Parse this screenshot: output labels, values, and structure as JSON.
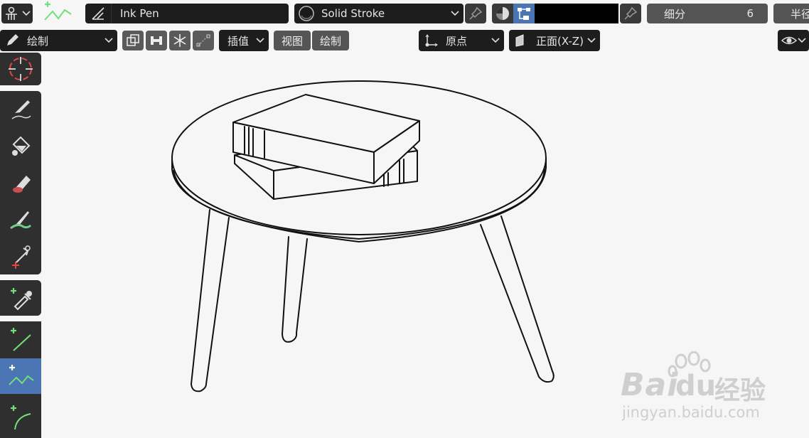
{
  "header": {
    "brush_name": "Ink Pen",
    "material_name": "Solid Stroke",
    "subdivision_label": "细分",
    "subdivision_value": "6",
    "radius_label": "半径"
  },
  "toolbar2": {
    "mode_label": "绘制",
    "interpolate_label": "插值",
    "view_label": "视图",
    "draw_label": "绘制",
    "origin_label": "原点",
    "orientation_label": "正面(X-Z)"
  },
  "colors": {
    "accent": "#4c75b3",
    "stroke_swatch": "#000000",
    "tool_green": "#6fe07a"
  },
  "tools": [
    {
      "icon": "cursor-icon"
    },
    {
      "icon": "draw-pencil-icon"
    },
    {
      "icon": "fill-bucket-icon"
    },
    {
      "icon": "erase-icon"
    },
    {
      "icon": "tint-brush-icon"
    },
    {
      "icon": "cutter-icon"
    },
    {
      "icon": "eyedropper-icon"
    },
    {
      "icon": "line-icon"
    },
    {
      "icon": "polyline-icon"
    },
    {
      "icon": "arc-icon"
    }
  ],
  "watermark": {
    "brand": "Bai",
    "brand2": "du",
    "suffix": "经验",
    "url": "jingyan.baidu.com"
  }
}
